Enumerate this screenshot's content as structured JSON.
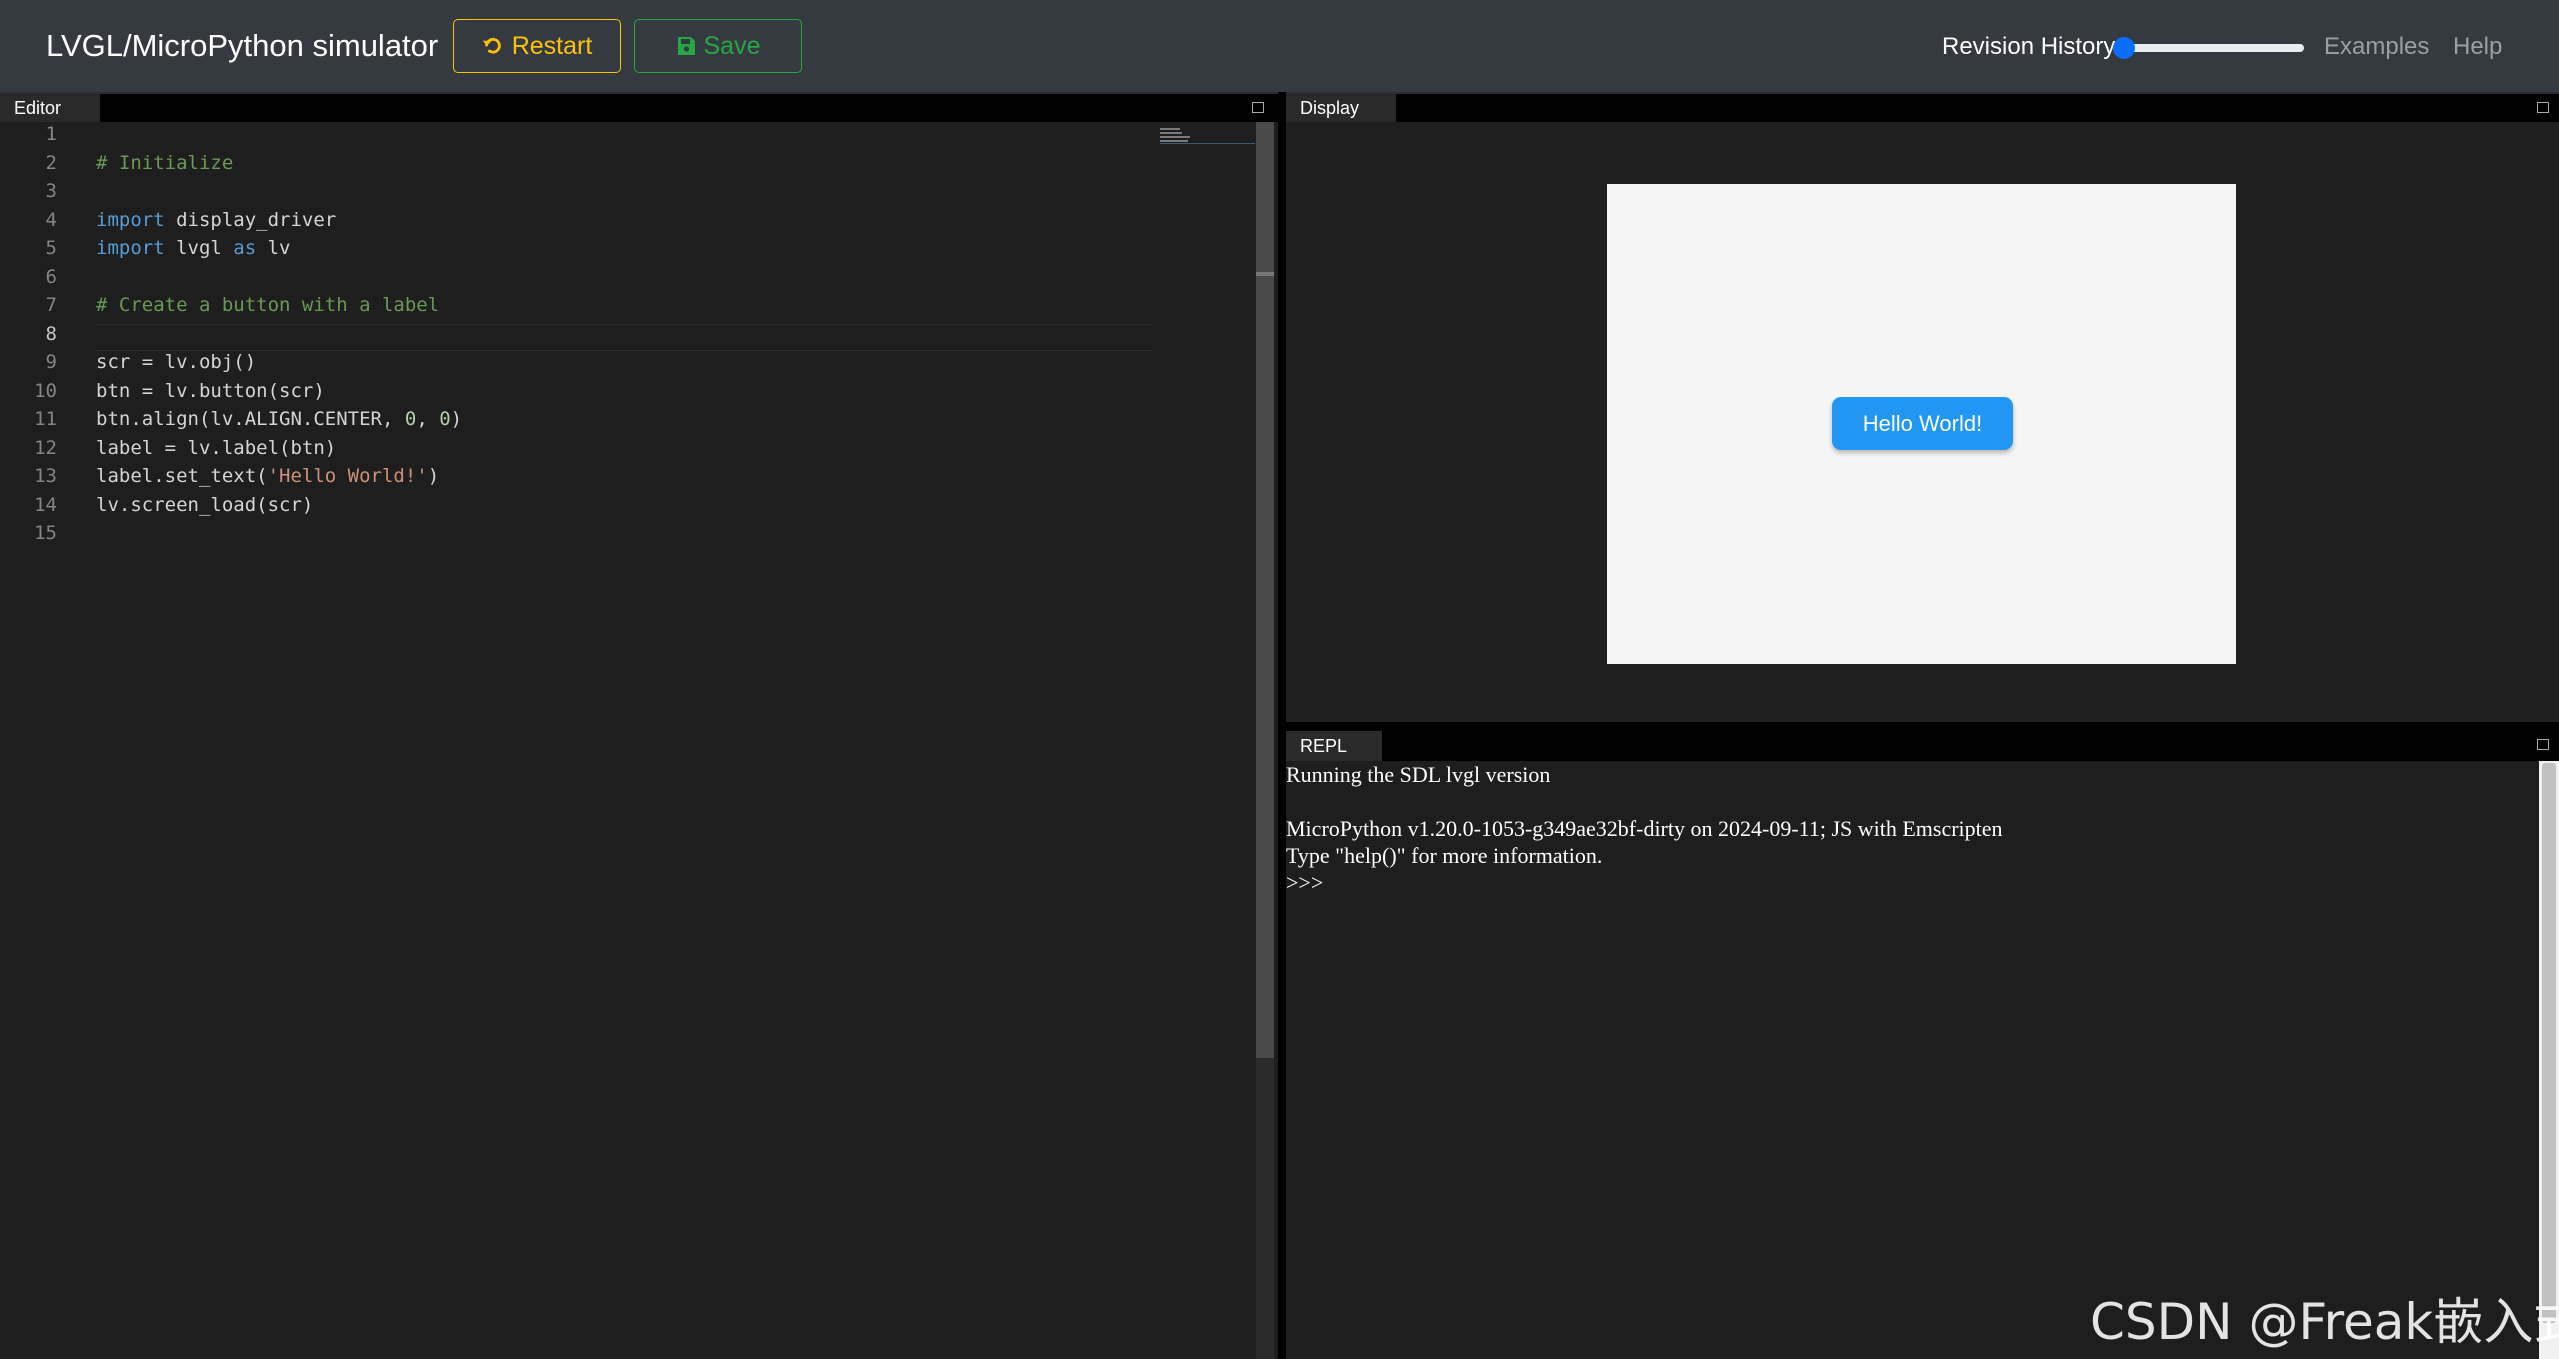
{
  "header": {
    "title": "LVGL/MicroPython simulator",
    "restart_label": "Restart",
    "save_label": "Save",
    "revision_history_label": "Revision History",
    "revision_slider_value": 0,
    "examples_label": "Examples",
    "help_label": "Help"
  },
  "editor": {
    "tab_label": "Editor",
    "active_line": 8,
    "line_numbers": [
      "1",
      "2",
      "3",
      "4",
      "5",
      "6",
      "7",
      "8",
      "9",
      "10",
      "11",
      "12",
      "13",
      "14",
      "15"
    ],
    "lines": [
      [],
      [
        {
          "t": "# Initialize",
          "c": "comment"
        }
      ],
      [],
      [
        {
          "t": "import",
          "c": "kw"
        },
        {
          "t": " display_driver"
        }
      ],
      [
        {
          "t": "import",
          "c": "kw"
        },
        {
          "t": " lvgl "
        },
        {
          "t": "as",
          "c": "kw"
        },
        {
          "t": " lv"
        }
      ],
      [],
      [
        {
          "t": "# Create a button with a label",
          "c": "comment"
        }
      ],
      [],
      [
        {
          "t": "scr = lv.obj()"
        }
      ],
      [
        {
          "t": "btn = lv.button(scr)"
        }
      ],
      [
        {
          "t": "btn.align(lv.ALIGN.CENTER, "
        },
        {
          "t": "0",
          "c": "num"
        },
        {
          "t": ", "
        },
        {
          "t": "0",
          "c": "num"
        },
        {
          "t": ")"
        }
      ],
      [
        {
          "t": "label = lv.label(btn)"
        }
      ],
      [
        {
          "t": "label.set_text("
        },
        {
          "t": "'Hello World!'",
          "c": "str"
        },
        {
          "t": ")"
        }
      ],
      [
        {
          "t": "lv.screen_load(scr)"
        }
      ],
      []
    ]
  },
  "display": {
    "tab_label": "Display",
    "button_text": "Hello World!"
  },
  "repl": {
    "tab_label": "REPL",
    "lines": [
      "Running the SDL lvgl version",
      "",
      "MicroPython v1.20.0-1053-g349ae32bf-dirty on 2024-09-11; JS with Emscripten",
      "Type \"help()\" for more information.",
      ">>>"
    ]
  },
  "watermark": "CSDN @Freak嵌入式",
  "colors": {
    "navbar": "#343a40",
    "restart": "#ffc107",
    "save": "#28a745",
    "hello_button": "#2196f3",
    "editor_bg": "#1e1e1e",
    "comment": "#6a9955",
    "keyword": "#569cd6",
    "string": "#ce9178",
    "number": "#b5cea8"
  }
}
